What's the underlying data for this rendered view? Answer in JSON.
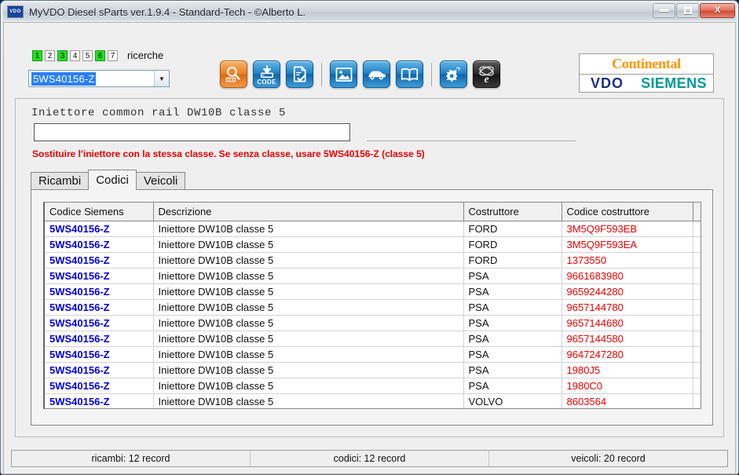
{
  "window": {
    "title": "MyVDO Diesel sParts  ver.1.9.4  -  Standard-Tech  -   ©Alberto L.",
    "app_icon_label": "VDO",
    "minimize_label": "",
    "maximize_label": "",
    "close_label": "X"
  },
  "toolbar": {
    "search_numbers": [
      {
        "label": "1",
        "active": true
      },
      {
        "label": "2",
        "active": false
      },
      {
        "label": "3",
        "active": true
      },
      {
        "label": "4",
        "active": false
      },
      {
        "label": "5",
        "active": false
      },
      {
        "label": "6",
        "active": true
      },
      {
        "label": "7",
        "active": false
      }
    ],
    "ricerche_label": "ricerche",
    "combo": {
      "value": "5WS40156-Z",
      "arrow": "▼"
    },
    "icons": [
      {
        "name": "barcode-search-icon",
        "style": "orange",
        "label": ""
      },
      {
        "name": "code-download-icon",
        "style": "blue",
        "label": "CODE"
      },
      {
        "name": "document-check-icon",
        "style": "blue",
        "label": ""
      },
      {
        "name": "image-icon",
        "style": "blue",
        "label": ""
      },
      {
        "name": "car-icon",
        "style": "blue",
        "label": ""
      },
      {
        "name": "book-icon",
        "style": "blue",
        "label": ""
      },
      {
        "name": "gears-settings-icon",
        "style": "blue",
        "label": ""
      },
      {
        "name": "internet-explorer-icon",
        "style": "dark",
        "label": ""
      }
    ]
  },
  "logo": {
    "top": "Continental",
    "vdo": "VDO",
    "siemens": "SIEMENS",
    "colors": {
      "continental_orange": "#ff9500",
      "vdo_blue": "#1a2f82",
      "siemens_teal": "#009999"
    }
  },
  "panel": {
    "part_title": "Iniettore common rail DW10B classe 5",
    "description_input": {
      "value": "",
      "placeholder": ""
    },
    "warning": "Sostituire l'iniettore con la stessa classe. Se senza classe, usare 5WS40156-Z (classe 5)",
    "warning_color": "#ee0000"
  },
  "tabs": [
    {
      "label": "Ricambi",
      "active": false
    },
    {
      "label": "Codici",
      "active": true
    },
    {
      "label": "Veicoli",
      "active": false
    }
  ],
  "table": {
    "columns": [
      "Codice Siemens",
      "Descrizione",
      "Costruttore",
      "Codice costruttore",
      ""
    ],
    "rows": [
      [
        "5WS40156-Z",
        "Iniettore DW10B classe 5",
        "FORD",
        "3M5Q9F593EB",
        ""
      ],
      [
        "5WS40156-Z",
        "Iniettore DW10B classe 5",
        "FORD",
        "3M5Q9F593EA",
        ""
      ],
      [
        "5WS40156-Z",
        "Iniettore DW10B classe 5",
        "FORD",
        "1373550",
        ""
      ],
      [
        "5WS40156-Z",
        "Iniettore DW10B classe 5",
        "PSA",
        "9661683980",
        ""
      ],
      [
        "5WS40156-Z",
        "Iniettore DW10B classe 5",
        "PSA",
        "9659244280",
        ""
      ],
      [
        "5WS40156-Z",
        "Iniettore DW10B classe 5",
        "PSA",
        "9657144780",
        ""
      ],
      [
        "5WS40156-Z",
        "Iniettore DW10B classe 5",
        "PSA",
        "9657144680",
        ""
      ],
      [
        "5WS40156-Z",
        "Iniettore DW10B classe 5",
        "PSA",
        "9657144580",
        ""
      ],
      [
        "5WS40156-Z",
        "Iniettore DW10B classe 5",
        "PSA",
        "9647247280",
        ""
      ],
      [
        "5WS40156-Z",
        "Iniettore DW10B classe 5",
        "PSA",
        "1980J5",
        ""
      ],
      [
        "5WS40156-Z",
        "Iniettore DW10B classe 5",
        "PSA",
        "1980C0",
        ""
      ],
      [
        "5WS40156-Z",
        "Iniettore DW10B classe 5",
        "VOLVO",
        "8603564",
        ""
      ],
      [
        "",
        "",
        "",
        "",
        ""
      ]
    ]
  },
  "statusbar": [
    "ricambi: 12 record",
    "codici: 12 record",
    "veicoli: 20 record"
  ]
}
